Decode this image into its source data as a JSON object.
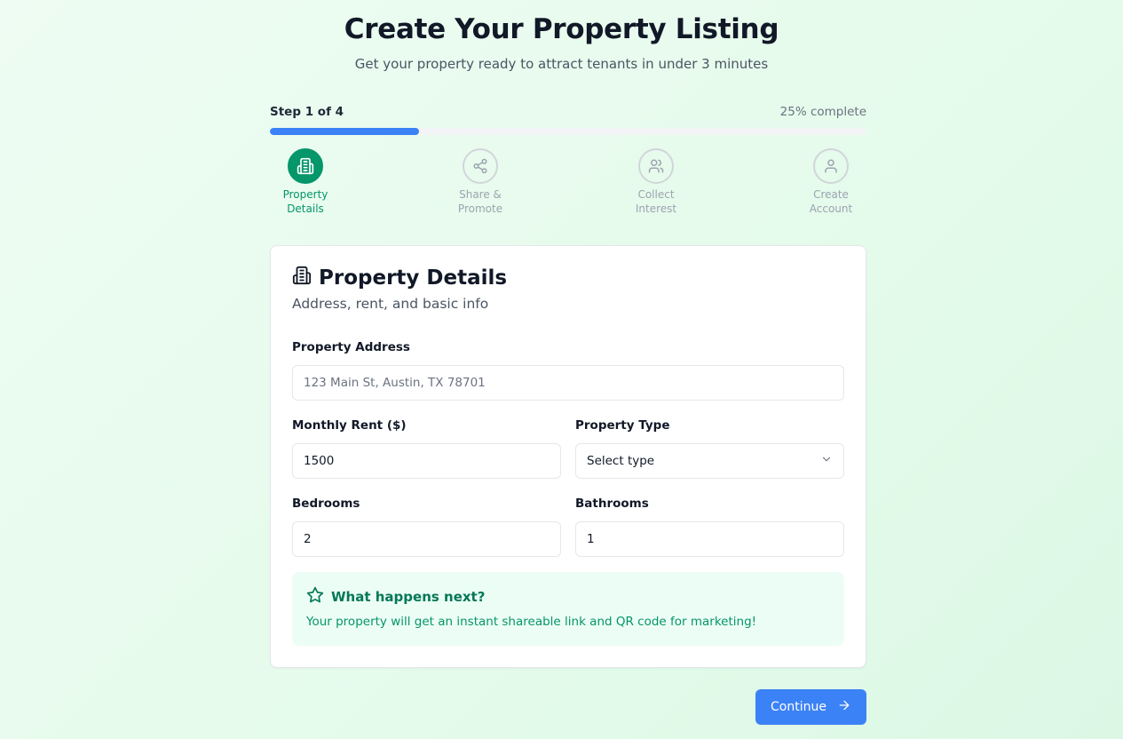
{
  "header": {
    "title": "Create Your Property Listing",
    "subtitle": "Get your property ready to attract tenants in under 3 minutes"
  },
  "progress": {
    "step_label": "Step 1 of 4",
    "percent_label": "25% complete",
    "percent": 25
  },
  "steps": [
    {
      "line1": "Property",
      "line2": "Details",
      "icon": "building-icon",
      "active": true
    },
    {
      "line1": "Share &",
      "line2": "Promote",
      "icon": "share-icon",
      "active": false
    },
    {
      "line1": "Collect",
      "line2": "Interest",
      "icon": "users-icon",
      "active": false
    },
    {
      "line1": "Create",
      "line2": "Account",
      "icon": "user-icon",
      "active": false
    }
  ],
  "card": {
    "title": "Property Details",
    "subtitle": "Address, rent, and basic info",
    "address": {
      "label": "Property Address",
      "placeholder": "123 Main St, Austin, TX 78701",
      "value": ""
    },
    "rent": {
      "label": "Monthly Rent ($)",
      "value": "1500"
    },
    "type": {
      "label": "Property Type",
      "value": "Select type"
    },
    "bedrooms": {
      "label": "Bedrooms",
      "value": "2"
    },
    "bathrooms": {
      "label": "Bathrooms",
      "value": "1"
    },
    "info": {
      "title": "What happens next?",
      "text": "Your property will get an instant shareable link and QR code for marketing!"
    }
  },
  "actions": {
    "continue_label": "Continue"
  },
  "colors": {
    "primary": "#3b82f6",
    "accent": "#059669"
  }
}
